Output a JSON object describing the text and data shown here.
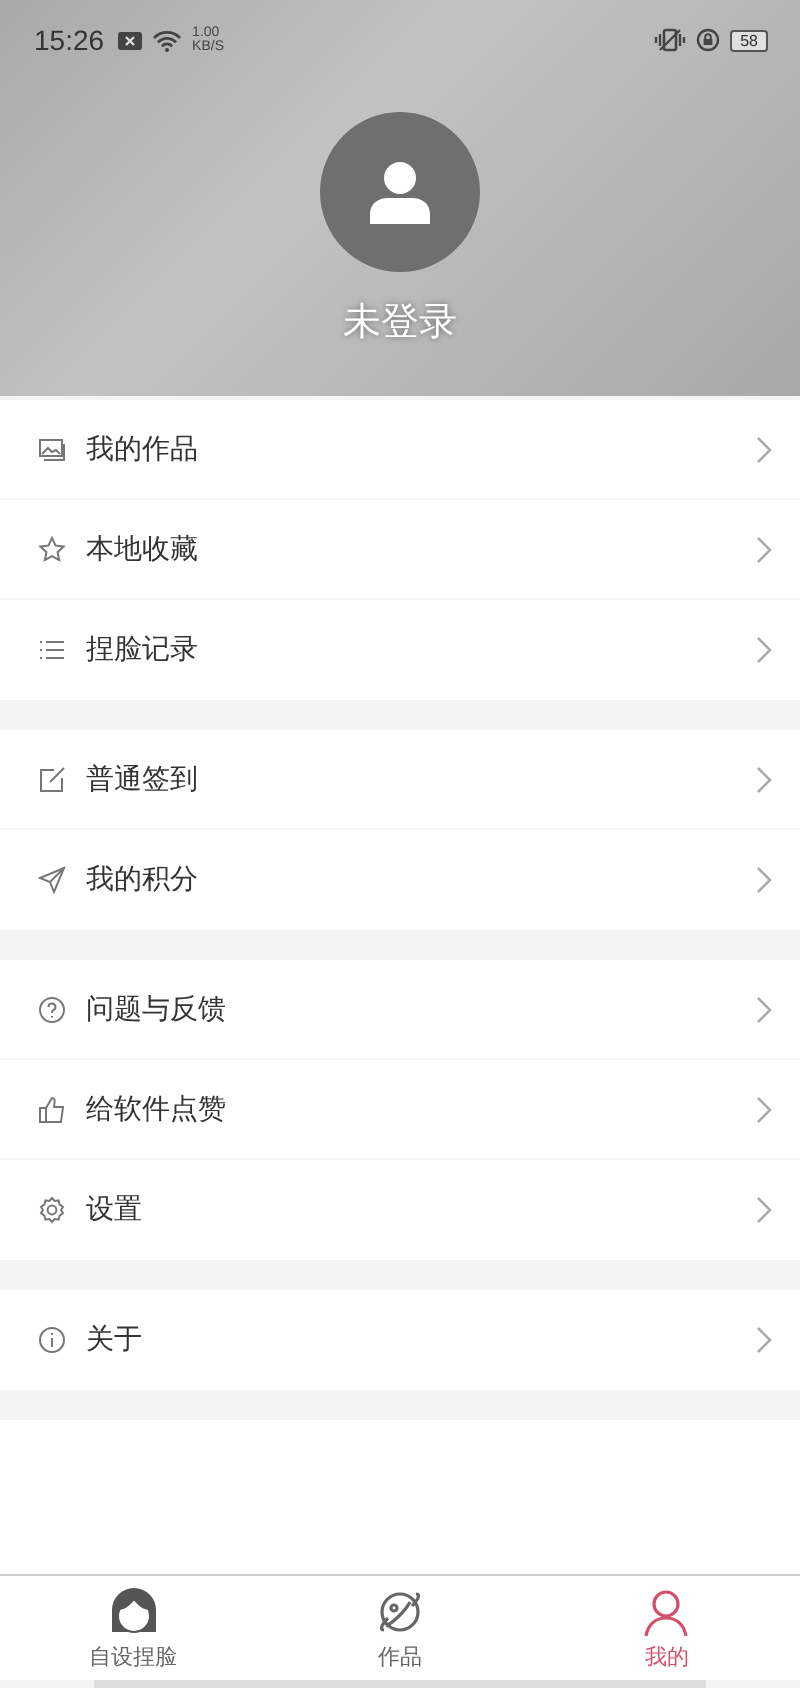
{
  "status_bar": {
    "time": "15:26",
    "speed_value": "1.00",
    "speed_unit": "KB/S",
    "battery": "58"
  },
  "profile": {
    "name": "未登录"
  },
  "menu_groups": [
    {
      "items": [
        {
          "kind": "picture",
          "label": "我的作品"
        },
        {
          "kind": "star",
          "label": "本地收藏"
        },
        {
          "kind": "list",
          "label": "捏脸记录"
        }
      ]
    },
    {
      "items": [
        {
          "kind": "edit",
          "label": "普通签到"
        },
        {
          "kind": "send",
          "label": "我的积分"
        }
      ]
    },
    {
      "items": [
        {
          "kind": "help",
          "label": "问题与反馈"
        },
        {
          "kind": "thumb",
          "label": "给软件点赞"
        },
        {
          "kind": "gear",
          "label": "设置"
        }
      ]
    },
    {
      "items": [
        {
          "kind": "info",
          "label": "关于"
        }
      ]
    }
  ],
  "tab_bar": [
    {
      "kind": "face",
      "label": "自设捏脸",
      "selected": false
    },
    {
      "kind": "planet",
      "label": "作品",
      "selected": false
    },
    {
      "kind": "person",
      "label": "我的",
      "selected": true
    }
  ]
}
